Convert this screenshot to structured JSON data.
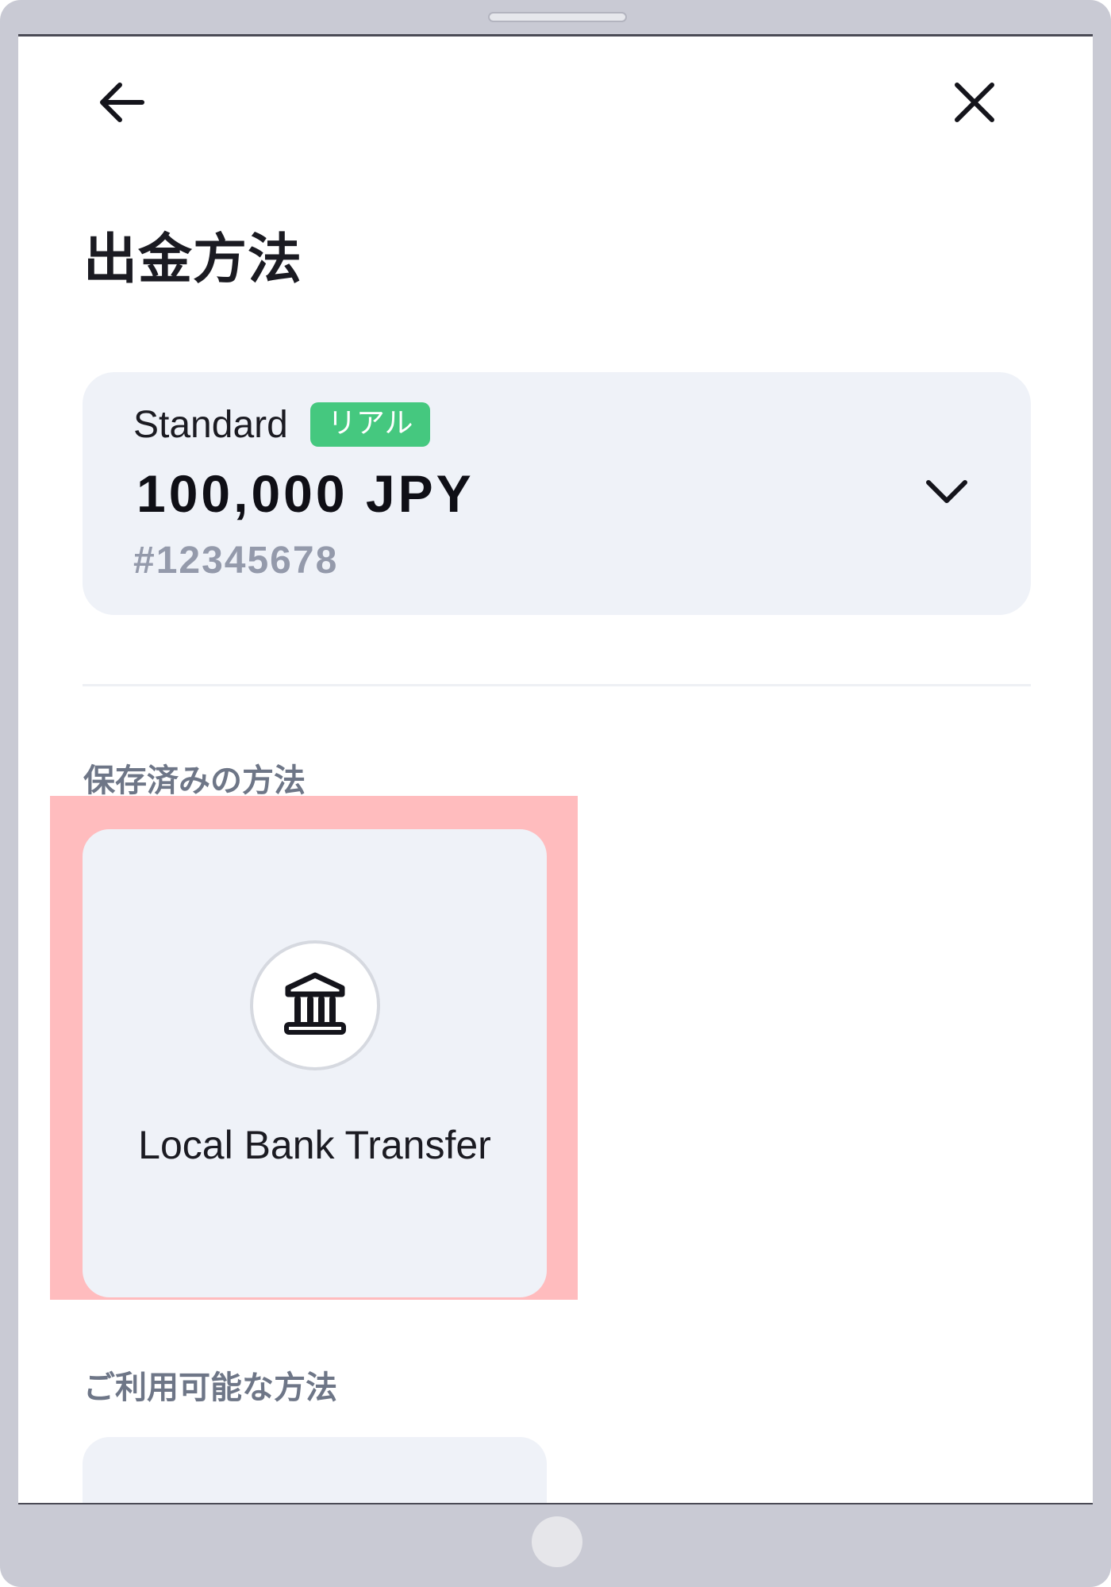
{
  "header": {
    "back_icon": "arrow-left-icon",
    "close_icon": "close-icon"
  },
  "page": {
    "title": "出金方法"
  },
  "account": {
    "type": "Standard",
    "badge": "リアル",
    "badge_color": "#45c87f",
    "balance": "100,000 JPY",
    "number": "#12345678",
    "dropdown_icon": "chevron-down-icon"
  },
  "saved_methods": {
    "label": "保存済みの方法",
    "items": [
      {
        "label": "Local Bank Transfer",
        "icon": "bank-icon"
      }
    ]
  },
  "available_methods": {
    "label": "ご利用可能な方法"
  },
  "highlight_color": "#ffbcbe"
}
